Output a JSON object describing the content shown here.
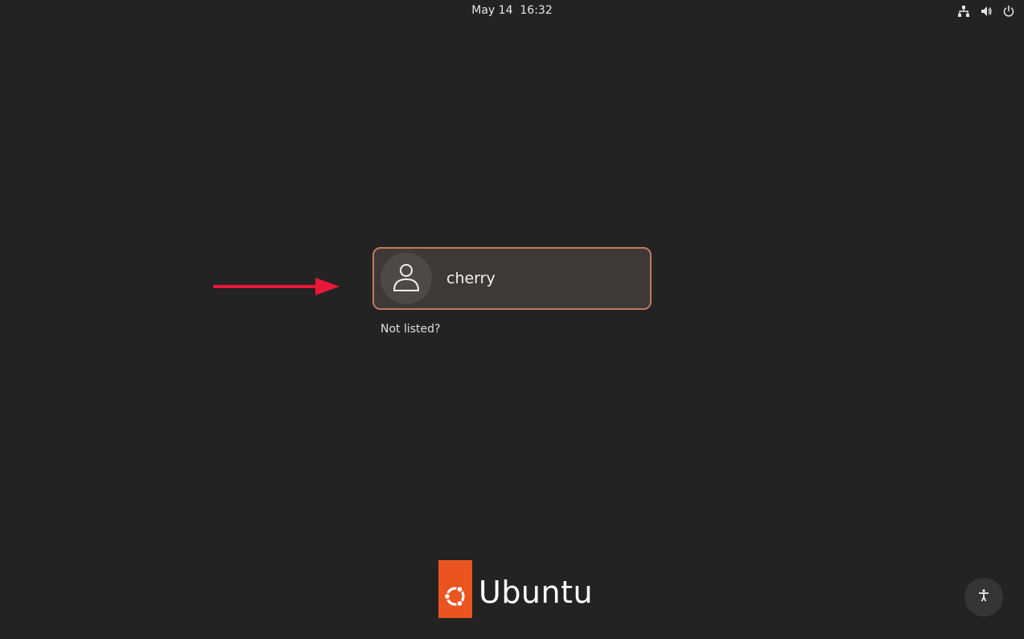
{
  "top_bar": {
    "clock": "May 14  16:32",
    "icons": [
      "network-icon",
      "volume-icon",
      "power-icon"
    ]
  },
  "user_list": {
    "users": [
      {
        "name": "cherry",
        "avatar_icon": "user-icon"
      }
    ],
    "not_listed_label": "Not listed?"
  },
  "annotation": {
    "arrow_color": "#e8173a"
  },
  "branding": {
    "logo_text": "Ubuntu",
    "logo_color": "#e95420"
  },
  "accessibility": {
    "icon": "accessibility-icon"
  },
  "colors": {
    "background": "#232323",
    "card_border": "#c07a5e",
    "card_bg": "#3d3938"
  }
}
